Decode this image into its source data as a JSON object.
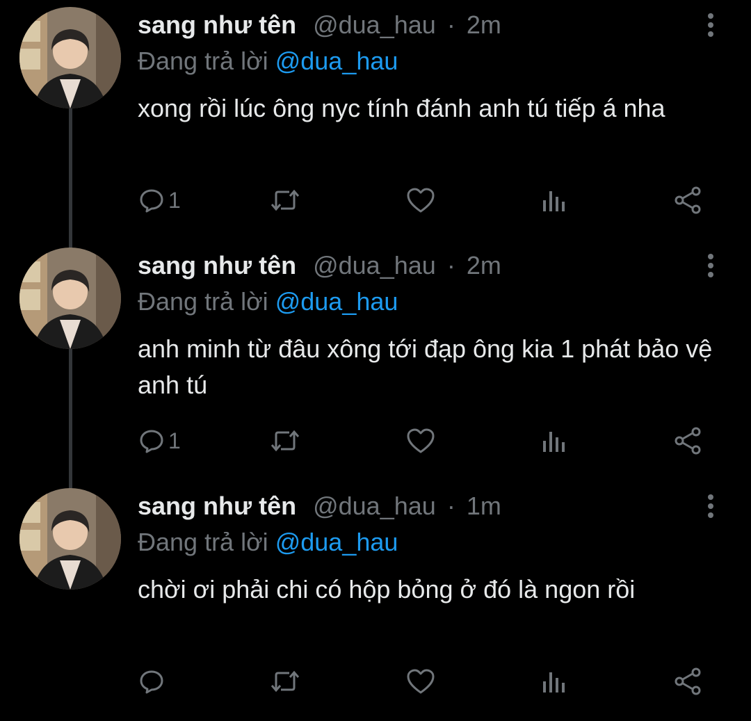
{
  "thread": {
    "tweets": [
      {
        "display_name": "sang như tên",
        "handle": "@dua_hau",
        "separator": "·",
        "time": "2m",
        "replying_prefix": "Đang trả lời",
        "replying_to": "@dua_hau",
        "text": "xong rồi lúc ông nyc tính đánh anh tú tiếp á nha",
        "reply_count": "1",
        "retweet_count": "",
        "like_count": "",
        "view_count": ""
      },
      {
        "display_name": "sang như tên",
        "handle": "@dua_hau",
        "separator": "·",
        "time": "2m",
        "replying_prefix": "Đang trả lời",
        "replying_to": "@dua_hau",
        "text": "anh minh từ đâu xông tới đạp ông kia 1 phát bảo vệ anh tú",
        "reply_count": "1",
        "retweet_count": "",
        "like_count": "",
        "view_count": ""
      },
      {
        "display_name": "sang như tên",
        "handle": "@dua_hau",
        "separator": "·",
        "time": "1m",
        "replying_prefix": "Đang trả lời",
        "replying_to": "@dua_hau",
        "text": "chời ơi phải chi có hộp bỏng ở đó là ngon rồi",
        "reply_count": "",
        "retweet_count": "",
        "like_count": "",
        "view_count": ""
      }
    ]
  },
  "icons": {
    "reply": "reply-bubble-icon",
    "retweet": "retweet-icon",
    "like": "heart-icon",
    "views": "bar-chart-icon",
    "share": "share-icon",
    "more": "more-vertical-icon",
    "avatar": "avatar"
  },
  "colors": {
    "background": "#000000",
    "primary_text": "#e7e9ea",
    "secondary_text": "#71767b",
    "mention": "#1d9bf0",
    "thread_line": "#333639"
  }
}
